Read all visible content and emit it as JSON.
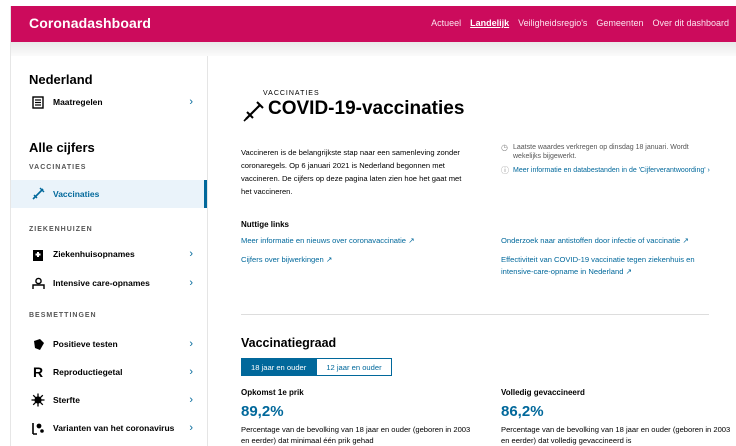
{
  "app": {
    "brand": "Coronadashboard",
    "nav": [
      {
        "label": "Actueel",
        "active": false
      },
      {
        "label": "Landelijk",
        "active": true
      },
      {
        "label": "Veiligheidsregio's",
        "active": false
      },
      {
        "label": "Gemeenten",
        "active": false
      },
      {
        "label": "Over dit dashboard",
        "active": false
      }
    ],
    "accent_color": "#cc0b5c",
    "link_color": "#01689b"
  },
  "sidebar": {
    "heading_nl": "Nederland",
    "item_maatregelen": {
      "label": "Maatregelen",
      "icon": "document-list-icon"
    },
    "heading_all": "Alle cijfers",
    "cat_vaccinaties": "VACCINATIES",
    "item_vaccinaties": {
      "label": "Vaccinaties",
      "icon": "syringe-icon",
      "active": true
    },
    "cat_ziekenhuizen": "ZIEKENHUIZEN",
    "item_ziekenhuis": {
      "label": "Ziekenhuisopnames",
      "icon": "hospital-icon"
    },
    "item_ic": {
      "label": "Intensive care-opnames",
      "icon": "ic-bed-icon"
    },
    "cat_besmettingen": "BESMETTINGEN",
    "item_positief": {
      "label": "Positieve testen",
      "icon": "test-tube-icon"
    },
    "item_r": {
      "label": "Reproductiegetal",
      "icon": "r-letter-icon"
    },
    "item_sterfte": {
      "label": "Sterfte",
      "icon": "virus-icon"
    },
    "item_varianten": {
      "label": "Varianten van het coronavirus",
      "icon": "variants-icon"
    },
    "chevron": "›"
  },
  "page": {
    "eyebrow": "VACCINATIES",
    "title": "COVID-19-vaccinaties",
    "intro": "Vaccineren is de belangrijkste stap naar een samenleving zonder coronaregels. Op 6 januari 2021 is Nederland begonnen met vaccineren. De cijfers op deze pagina laten zien hoe het gaat met het vaccineren.",
    "meta_updated": "Laatste waardes verkregen op dinsdag 18 januari. Wordt wekelijks bijgewerkt.",
    "meta_info": "Meer informatie en databestanden in de 'Cijferverantwoording' ›",
    "links_heading": "Nuttige links",
    "links": [
      "Meer informatie en nieuws over coronavaccinatie ↗",
      "Cijfers over bijwerkingen ↗",
      "Onderzoek naar antistoffen door infectie of vaccinatie ↗",
      "Effectiviteit van COVID-19 vaccinatie tegen ziekenhuis en intensive-care-opname in Nederland ↗"
    ],
    "section_heading": "Vaccinatiegraad",
    "tabs": [
      {
        "label": "18 jaar en ouder",
        "active": true
      },
      {
        "label": "12 jaar en ouder",
        "active": false
      }
    ],
    "kpi1": {
      "title": "Opkomst 1e prik",
      "value": "89,2%",
      "desc": "Percentage van de bevolking van 18 jaar en ouder (geboren in 2003 en eerder) dat minimaal één prik gehad"
    },
    "kpi2": {
      "title": "Volledig gevaccineerd",
      "value": "86,2%",
      "desc": "Percentage van de bevolking van 18 jaar en ouder (geboren in 2003 en eerder) dat volledig gevaccineerd is"
    }
  }
}
